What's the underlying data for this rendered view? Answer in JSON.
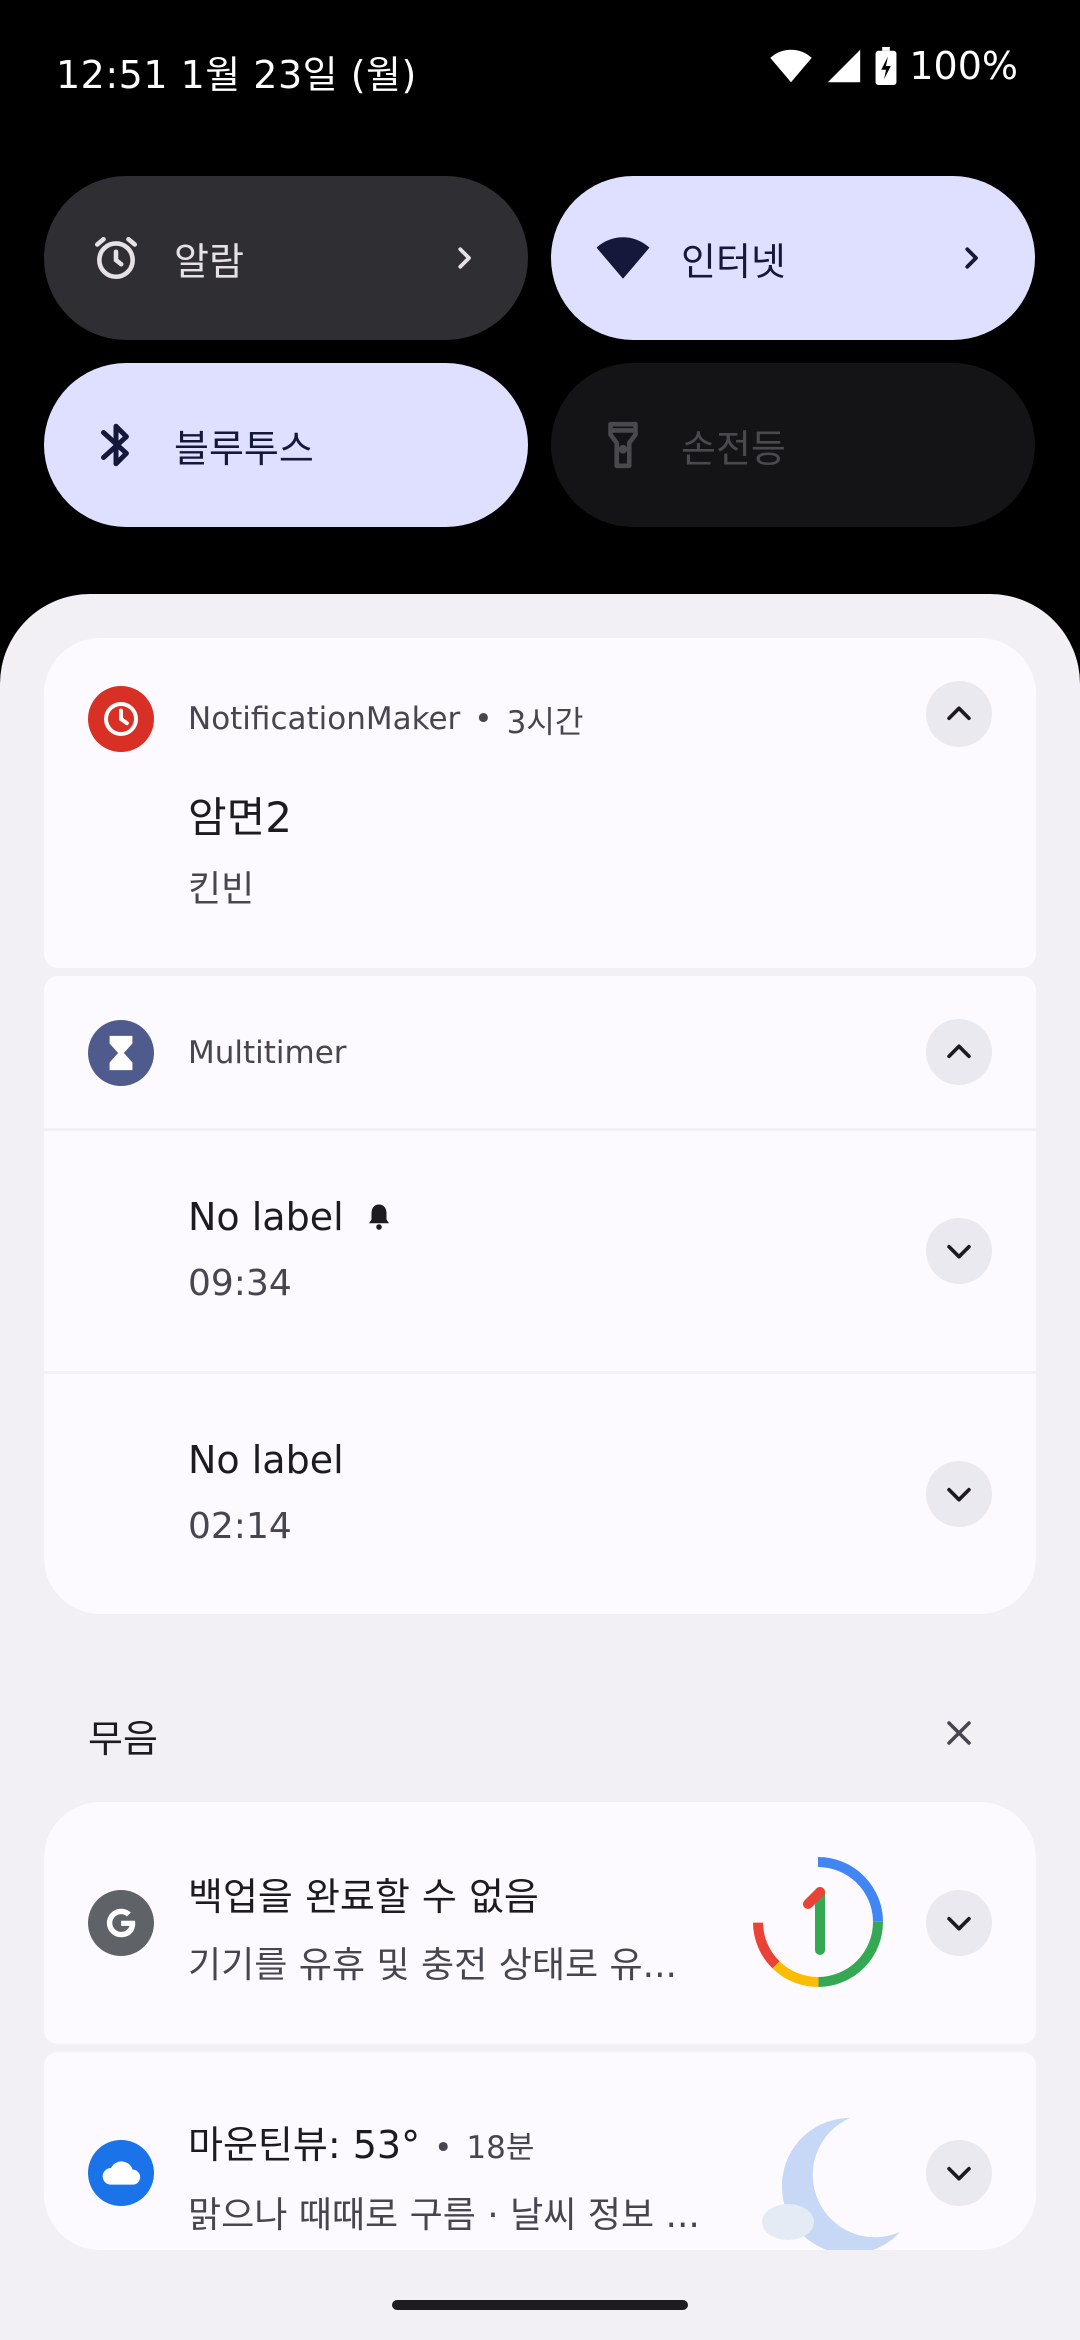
{
  "status_bar": {
    "time": "12:51 1월 23일 (월)",
    "battery": "100%",
    "icons": [
      "wifi-icon",
      "signal-icon",
      "battery-charging-icon"
    ]
  },
  "quick_settings": {
    "tiles": [
      {
        "label": "알람",
        "icon": "alarm-clock-icon",
        "state": "off"
      },
      {
        "label": "인터넷",
        "icon": "wifi-icon",
        "state": "on"
      },
      {
        "label": "블루투스",
        "icon": "bluetooth-icon",
        "state": "on"
      },
      {
        "label": "손전등",
        "icon": "flashlight-icon",
        "state": "unavailable"
      }
    ]
  },
  "notifications": {
    "notification_maker": {
      "app": "NotificationMaker",
      "time": "3시간",
      "title": "암면2",
      "text": "킨빈",
      "icon": "clock-icon",
      "icon_color": "#d93025"
    },
    "multitimer": {
      "app": "Multitimer",
      "icon": "hourglass-icon",
      "icon_color": "#4f5b8d",
      "items": [
        {
          "title": "No label",
          "time": "09:34",
          "bell": "bell-icon"
        },
        {
          "title": "No label",
          "time": "02:14"
        }
      ]
    }
  },
  "silent_section": {
    "label": "무음",
    "close_icon": "close-icon",
    "backup": {
      "title": "백업을 완료할 수 없음",
      "text": "기기를 유휴 및 충전 상태로 유...",
      "icon": "google-g-icon",
      "icon_color": "#5f6368",
      "image": "google-one-logo"
    },
    "weather": {
      "title": "마운틴뷰: 53°",
      "time": "18분",
      "text": "맑으나 때때로 구름 · 날씨 정보 ...",
      "icon": "cloud-icon",
      "icon_color": "#1a73e8",
      "image": "moon-cloud-icon"
    }
  },
  "colors": {
    "shade_bg": "#f2f0f5",
    "card_bg": "#fcfaff",
    "tile_active": "#dfe0ff",
    "tile_inactive": "#2f2f33"
  }
}
